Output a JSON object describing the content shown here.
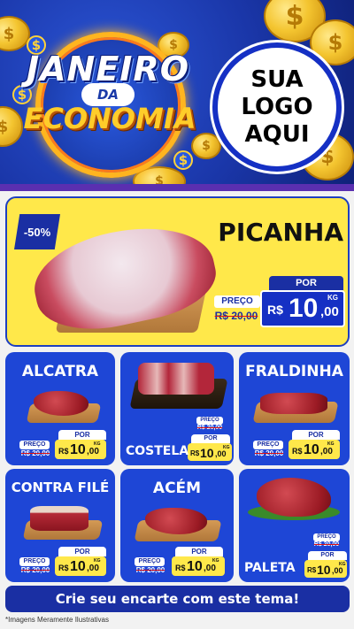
{
  "header": {
    "title_line1": "JANEIRO",
    "title_da": "DA",
    "title_line2": "ECONOMIA",
    "logo_line1": "SUA",
    "logo_line2": "LOGO",
    "logo_line3": "AQUI",
    "coin_symbol": "$"
  },
  "featured": {
    "discount": "-50%",
    "name": "PICANHA",
    "preco_label": "PREÇO",
    "old_price": "R$ 20,00",
    "por_label": "POR",
    "currency": "R$",
    "price_int": "10",
    "price_dec": ",00",
    "unit": "KG"
  },
  "products": [
    {
      "name": "ALCATRA",
      "preco_label": "PREÇO",
      "old_price": "R$ 20,00",
      "por_label": "POR",
      "currency": "R$",
      "price_int": "10",
      "price_dec": ",00",
      "unit": "KG"
    },
    {
      "name": "COSTELA",
      "preco_label": "PREÇO",
      "old_price": "R$ 20,00",
      "por_label": "POR",
      "currency": "R$",
      "price_int": "10",
      "price_dec": ",00",
      "unit": "KG"
    },
    {
      "name": "FRALDINHA",
      "preco_label": "PREÇO",
      "old_price": "R$ 20,00",
      "por_label": "POR",
      "currency": "R$",
      "price_int": "10",
      "price_dec": ",00",
      "unit": "KG"
    },
    {
      "name": "CONTRA FILÉ",
      "preco_label": "PREÇO",
      "old_price": "R$ 20,00",
      "por_label": "POR",
      "currency": "R$",
      "price_int": "10",
      "price_dec": ",00",
      "unit": "KG"
    },
    {
      "name": "ACÉM",
      "preco_label": "PREÇO",
      "old_price": "R$ 20,00",
      "por_label": "POR",
      "currency": "R$",
      "price_int": "10",
      "price_dec": ",00",
      "unit": "KG"
    },
    {
      "name": "PALETA",
      "preco_label": "PREÇO",
      "old_price": "R$ 20,00",
      "por_label": "POR",
      "currency": "R$",
      "price_int": "10",
      "price_dec": ",00",
      "unit": "KG"
    }
  ],
  "footer": {
    "cta": "Crie seu encarte com este tema!",
    "disclaimer": "*Imagens Meramente Ilustrativas"
  },
  "colors": {
    "primary_blue": "#1e46d6",
    "dark_blue": "#1a2fa3",
    "yellow": "#ffe84a",
    "gold": "#f4c530"
  }
}
